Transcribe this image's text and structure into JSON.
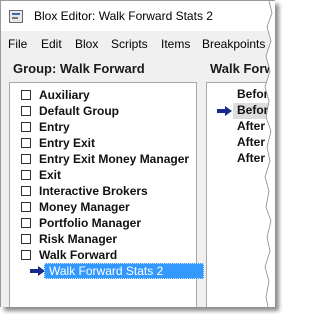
{
  "window": {
    "title": "Blox Editor: Walk Forward Stats 2"
  },
  "menu": {
    "items": [
      "File",
      "Edit",
      "Blox",
      "Scripts",
      "Items",
      "Breakpoints"
    ]
  },
  "left_panel": {
    "header": "Group: Walk Forward",
    "items": [
      "Auxiliary",
      "Default Group",
      "Entry",
      "Entry Exit",
      "Entry Exit Money Manager",
      "Exit",
      "Interactive Brokers",
      "Money Manager",
      "Portfolio Manager",
      "Risk Manager",
      "Walk Forward"
    ],
    "selected_child": "Walk Forward Stats 2"
  },
  "right_panel": {
    "header": "Walk Forw",
    "items": [
      "Before",
      "Before",
      "After",
      "After",
      "After"
    ],
    "selected_index": 1
  },
  "colors": {
    "selection": "#3399ff",
    "arrow": "#1a2a8c"
  }
}
